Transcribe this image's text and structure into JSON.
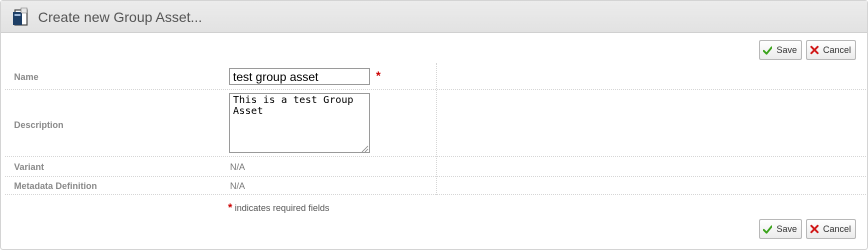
{
  "header": {
    "title": "Create new Group Asset..."
  },
  "toolbar": {
    "save_label": "Save",
    "cancel_label": "Cancel"
  },
  "form": {
    "name": {
      "label": "Name",
      "value": "test group asset"
    },
    "description": {
      "label": "Description",
      "value": "This is a test Group Asset"
    },
    "variant": {
      "label": "Variant",
      "value": "N/A"
    },
    "metadata_definition": {
      "label": "Metadata Definition",
      "value": "N/A"
    },
    "required_marker": "*",
    "required_note": "indicates required fields"
  },
  "colors": {
    "required": "#cc0000",
    "save_check": "#3aa31a",
    "cancel_x": "#d01818"
  },
  "icons": {
    "header": "document-icon",
    "save": "checkmark-icon",
    "cancel": "x-icon"
  }
}
